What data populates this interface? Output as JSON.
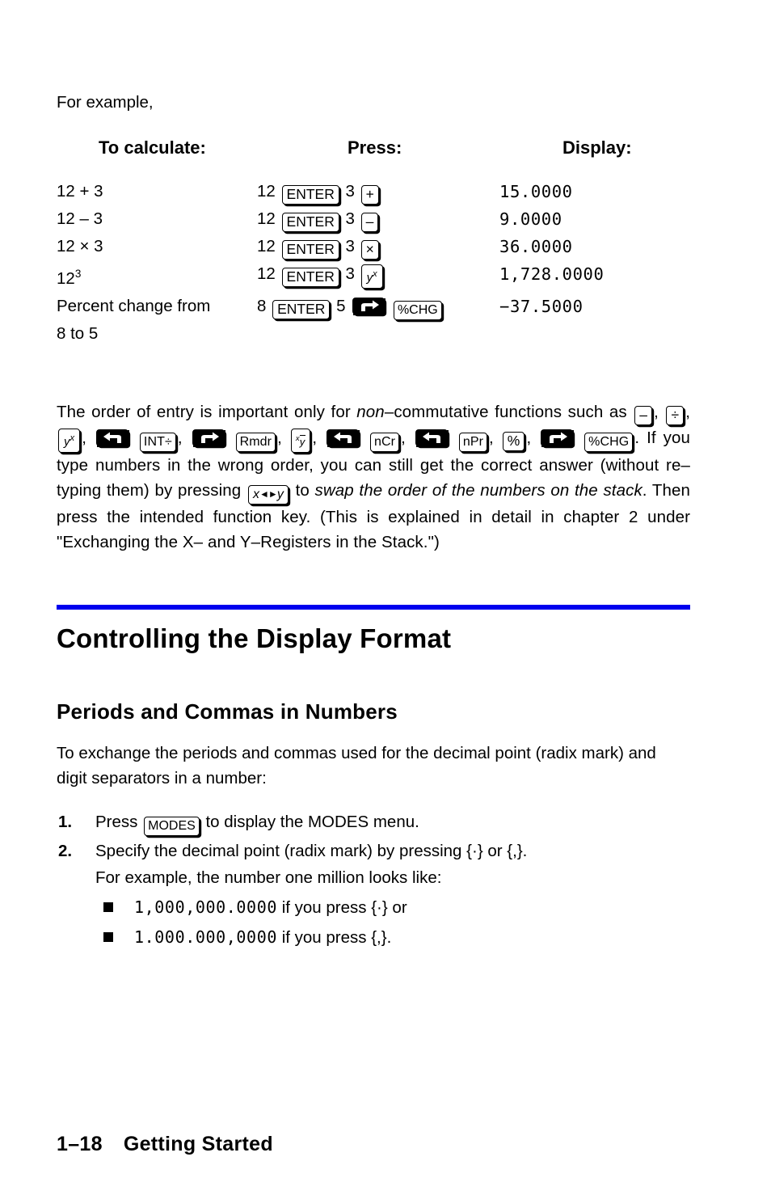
{
  "intro": {
    "lead": "For example,"
  },
  "example_table": {
    "headers": {
      "calculate": "To calculate:",
      "press": "Press:",
      "display": "Display:"
    },
    "rows": [
      {
        "calc_text": "12 + 3",
        "press_prefix": "12",
        "press_key1": "ENTER",
        "press_mid": "3",
        "press_key2": "+",
        "display": "15.0000"
      },
      {
        "calc_text": "12 – 3",
        "press_prefix": "12",
        "press_key1": "ENTER",
        "press_mid": "3",
        "press_key2": "–",
        "display": "9.0000"
      },
      {
        "calc_text": "12 × 3",
        "press_prefix": "12",
        "press_key1": "ENTER",
        "press_mid": "3",
        "press_key2": "×",
        "display": "36.0000"
      },
      {
        "calc_base": "12",
        "calc_exp": "3",
        "press_prefix": "12",
        "press_key1": "ENTER",
        "press_mid": "3",
        "press_key2_y": "y",
        "press_key2_x": "x",
        "display": "1,728.0000"
      },
      {
        "calc_line1": "Percent change from",
        "calc_line2": "8 to 5",
        "press_prefix": "8",
        "press_key1": "ENTER",
        "press_mid": "5",
        "press_key_shift": "right-shift-icon",
        "press_key2": "%CHG",
        "display": "−37.5000"
      }
    ]
  },
  "order_para": {
    "t1": "The order of entry is important only for ",
    "t2_italic": "non",
    "t3": "–commutative functions such as ",
    "keys": {
      "minus": "–",
      "divide": "÷",
      "y_base": "y",
      "y_exp": "x",
      "int_div": "INT÷",
      "rmdr": "Rmdr",
      "ncr": "nCr",
      "npr": "nPr",
      "percent": "%",
      "pct_chg": "%CHG",
      "swap_x": "x",
      "swap_y": "y"
    },
    "t4": ". If you type numbers in the wrong order, you can still get the correct answer (without re–typing them) by pressing ",
    "t5": " to ",
    "t6_italic": "swap the order of the numbers on the stack",
    "t7": ". Then press the intended function key. (This is explained in detail in chapter 2 under \"Exchanging the X– and Y–Registers in the Stack.\")"
  },
  "section": {
    "rule_color": "#0000ee",
    "heading": "Controlling the Display Format",
    "subheading": "Periods and Commas in Numbers",
    "intro_para": "To exchange the periods and commas used for the decimal point (radix mark) and digit separators in a number:",
    "steps": [
      {
        "num": "1.",
        "pre": "Press ",
        "key": "MODES",
        "post": " to display the MODES menu."
      },
      {
        "num": "2.",
        "line1": "Specify the decimal point (radix mark) by pressing {·} or {,}.",
        "line2": "For example, the number one million looks like:"
      }
    ],
    "bullets": [
      {
        "lcd": "1,000,000.0000",
        "text": "if you press {·} or"
      },
      {
        "lcd": "1.000.000,0000",
        "text": "if you press {,}."
      }
    ]
  },
  "footer": {
    "page_number": "1–18",
    "chapter_title": "Getting Started"
  }
}
